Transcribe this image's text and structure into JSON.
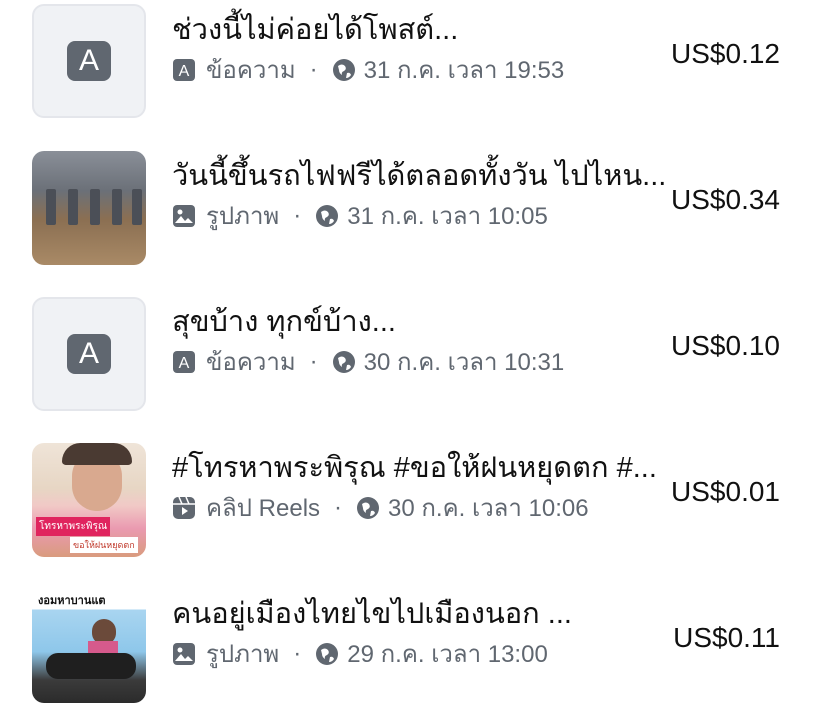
{
  "items": [
    {
      "title": "ช่วงนี้ไม่ค่อยได้โพสต์...",
      "type_label": "ข้อความ",
      "type_icon": "text-post-icon",
      "date": "31 ก.ค. เวลา 19:53",
      "price": "US$0.12",
      "thumb_letter": "A"
    },
    {
      "title": "วันนี้ขึ้นรถไฟฟรีได้ตลอดทั้งวัน ไปไหน...",
      "type_label": "รูปภาพ",
      "type_icon": "photo-icon",
      "date": "31 ก.ค. เวลา 10:05",
      "price": "US$0.34"
    },
    {
      "title": "สุขบ้าง ทุกข์บ้าง...",
      "type_label": "ข้อความ",
      "type_icon": "text-post-icon",
      "date": "30 ก.ค. เวลา 10:31",
      "price": "US$0.10",
      "thumb_letter": "A"
    },
    {
      "title": "#โทรหาพระพิรุณ #ขอให้ฝนหยุดตก #...",
      "type_label": "คลิป Reels",
      "type_icon": "reels-icon",
      "date": "30 ก.ค. เวลา 10:06",
      "price": "US$0.01",
      "thumb_caption_1": "โทรหาพระพิรุณ",
      "thumb_caption_2": "ขอให้ฝนหยุดตก"
    },
    {
      "title": "คนอยู่เมืองไทยไขไปเมืองนอก ...",
      "type_label": "รูปภาพ",
      "type_icon": "photo-icon",
      "date": "29 ก.ค. เวลา 13:00",
      "price": "US$0.11",
      "thumb_caption_1": "งอมหาบานแต"
    }
  ],
  "separator": "·",
  "colors": {
    "text": "#111111",
    "meta": "#606770",
    "thumb_bg": "#f0f2f5"
  }
}
